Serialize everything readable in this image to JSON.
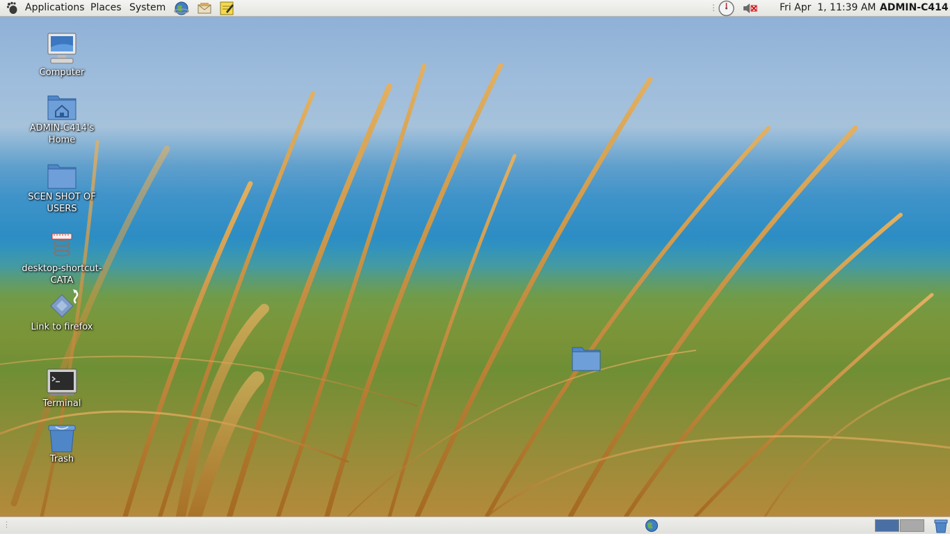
{
  "top_panel": {
    "menus": {
      "applications": "Applications",
      "places": "Places",
      "system": "System"
    },
    "launchers": [
      "web-browser-icon",
      "email-client-icon",
      "notes-icon"
    ],
    "clock": "Fri Apr  1, 11:39 AM",
    "user": "ADMIN-C414",
    "tray": [
      "timer-applet-icon",
      "volume-muted-icon"
    ]
  },
  "desktop": {
    "icons": {
      "computer": "Computer",
      "home": "ADMIN-C414's Home",
      "scen_shot": "SCEN SHOT OF USERS",
      "shortcut": "desktop-shortcut-CATA",
      "firefox_link": "Link to firefox",
      "terminal": "Terminal",
      "trash": "Trash"
    }
  },
  "bottom_panel": {
    "workspaces": [
      "workspace-1",
      "workspace-2"
    ],
    "active_workspace": 1
  },
  "colors": {
    "panel": "#ececea",
    "folder_blue": "#5b8ccf",
    "active_workspace": "#4a6fa5"
  }
}
